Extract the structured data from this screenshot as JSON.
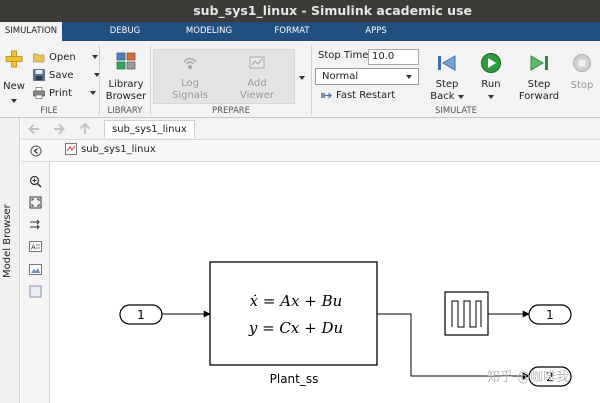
{
  "window": {
    "title": "sub_sys1_linux - Simulink academic use"
  },
  "tabs": [
    {
      "label": "SIMULATION",
      "active": true
    },
    {
      "label": "DEBUG"
    },
    {
      "label": "MODELING"
    },
    {
      "label": "FORMAT"
    },
    {
      "label": "APPS"
    }
  ],
  "ribbon": {
    "file": {
      "new": "New",
      "open": "Open",
      "save": "Save",
      "print": "Print",
      "group": "FILE"
    },
    "library": {
      "browser_line1": "Library",
      "browser_line2": "Browser",
      "group": "LIBRARY"
    },
    "prepare": {
      "log_line1": "Log",
      "log_line2": "Signals",
      "viewer_line1": "Add",
      "viewer_line2": "Viewer",
      "group": "PREPARE"
    },
    "simulate": {
      "stop_time_label": "Stop Time",
      "stop_time_value": "10.0",
      "mode": "Normal",
      "fast_restart": "Fast Restart",
      "step_back_line1": "Step",
      "step_back_line2": "Back",
      "run": "Run",
      "step_forward_line1": "Step",
      "step_forward_line2": "Forward",
      "stop": "Stop",
      "group": "SIMULATE"
    }
  },
  "side": {
    "model_browser": "Model Browser"
  },
  "nav": {
    "tab": "sub_sys1_linux",
    "address": "sub_sys1_linux"
  },
  "diagram": {
    "inport": "1",
    "block_eq1": "ẋ = Ax + Bu",
    "block_eq2": "y = Cx + Du",
    "block_name": "Plant_ss",
    "outport1": "1",
    "outport2": "2"
  },
  "watermark": "知乎 @咖啡我",
  "colors": {
    "tabbar": "#1f4f80",
    "titlebar": "#3c3b37",
    "ribbon": "#f3f3f3",
    "run_green": "#2e9b3a"
  }
}
